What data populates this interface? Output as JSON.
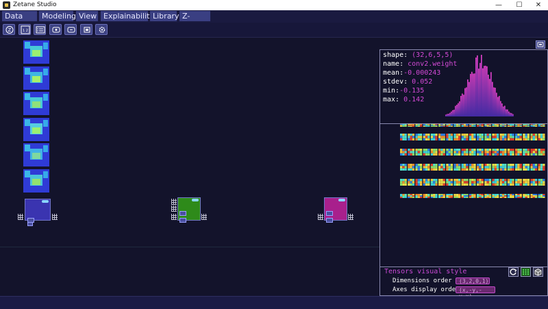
{
  "window": {
    "title": "Zetane Studio",
    "minimize": "—",
    "maximize": "☐",
    "close": "✕"
  },
  "menu": [
    "Data I/O",
    "Modeling",
    "View",
    "Explainability",
    "Library",
    "Z-editing"
  ],
  "toolbar": {
    "icons": [
      "zoom-icon",
      "number-icon",
      "list-icon",
      "add-node-icon",
      "connect-icon",
      "export-icon",
      "settings-icon"
    ],
    "first_label": "Z",
    "second_label": "1 2"
  },
  "colors": {
    "accent": "#3a3f82",
    "magenta": "#d44ad6",
    "node_blue": "#3a34b0",
    "node_green": "#2e8a1a",
    "node_magenta": "#a8208c"
  },
  "tensor": {
    "shape_label": "shape:",
    "shape": "(32,6,5,5)",
    "name_label": "name:",
    "name": "conv2.weight",
    "mean_label": "mean:",
    "mean": "-0.000243",
    "stdev_label": "stdev:",
    "stdev": "0.052",
    "min_label": "min:",
    "min": "-0.135",
    "max_label": "max:",
    "max": "0.142"
  },
  "style_panel": {
    "title": "Tensors visual style",
    "dimensions_label": "Dimensions order",
    "dimensions_value": "(3,2,0,1)",
    "axes_label": "Axes display order",
    "axes_value": "(x,-y,-y,x)"
  }
}
